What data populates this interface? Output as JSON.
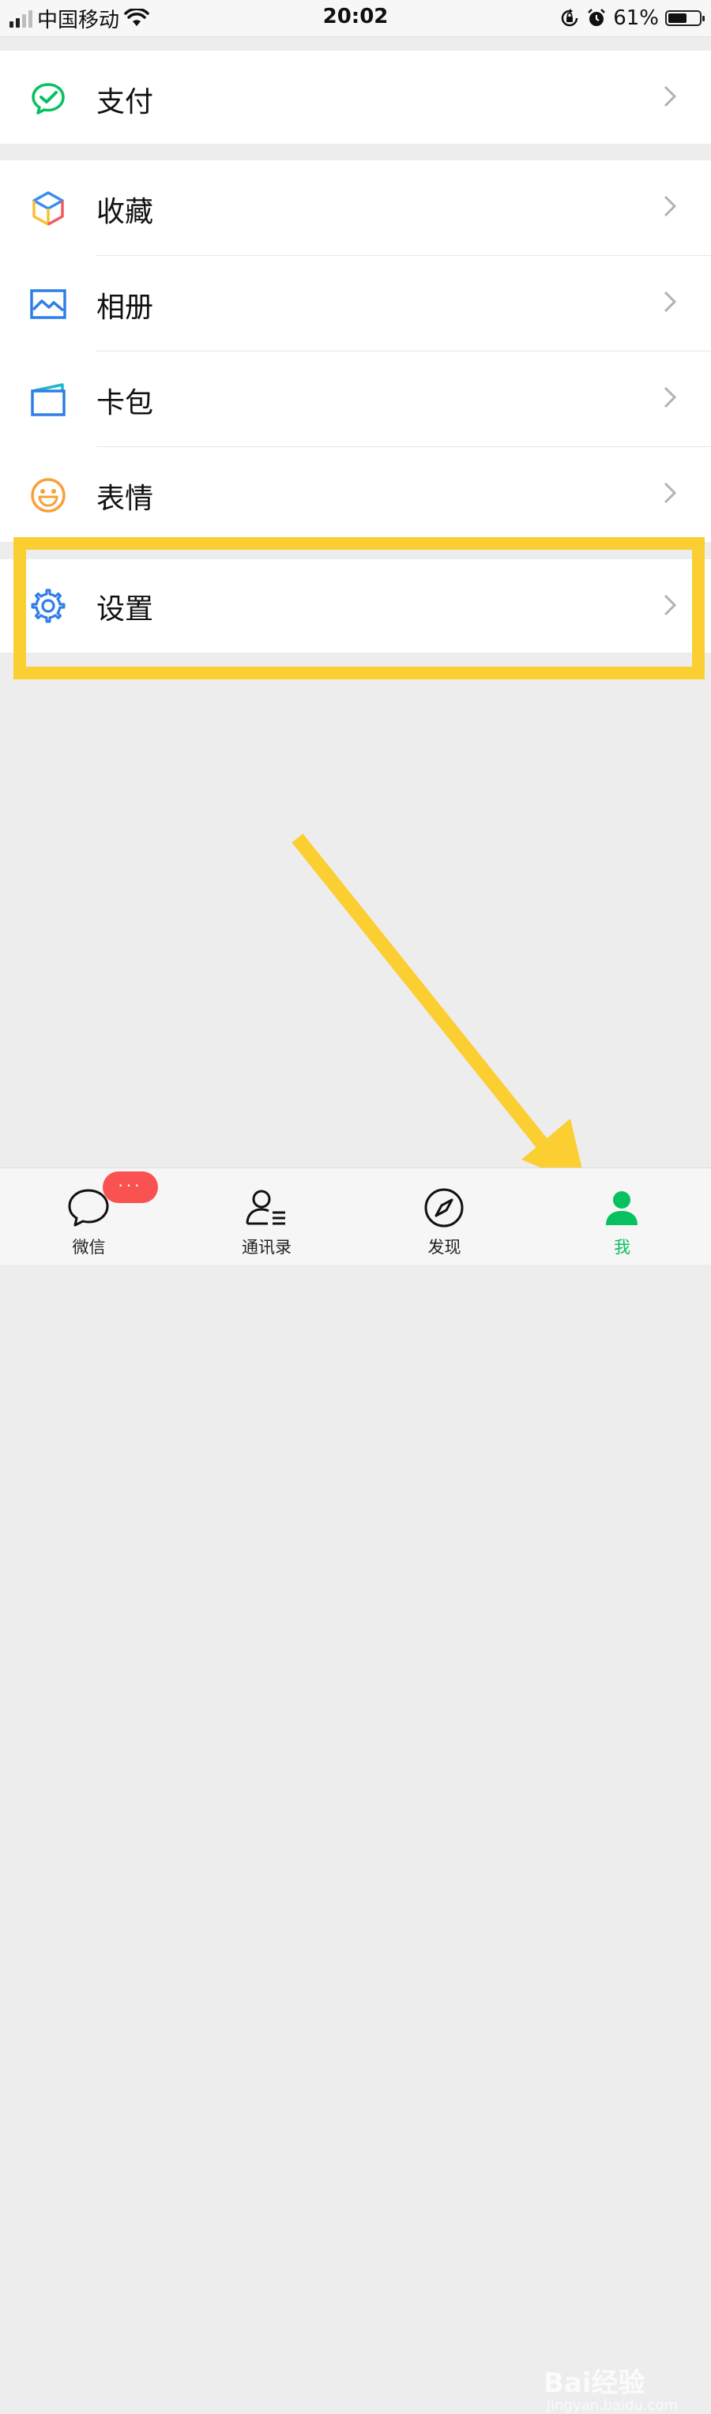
{
  "status_bar": {
    "carrier": "中国移动",
    "time": "20:02",
    "battery_percent": "61%",
    "battery_level": 0.61,
    "icons": [
      "signal-icon",
      "wifi-icon",
      "rotation-lock-icon",
      "alarm-icon",
      "battery-icon"
    ]
  },
  "header": {
    "camera_icon": "camera-icon"
  },
  "menu": {
    "pay": {
      "label": "支付",
      "icon": "wechat-pay-icon",
      "color": "#07c160"
    },
    "favorites": {
      "label": "收藏",
      "icon": "favorites-cube-icon"
    },
    "album": {
      "label": "相册",
      "icon": "album-icon",
      "color": "#2f7ee8"
    },
    "cards": {
      "label": "卡包",
      "icon": "card-wallet-icon",
      "color": "#2f7ee8"
    },
    "stickers": {
      "label": "表情",
      "icon": "sticker-smile-icon",
      "color": "#f5a13a"
    },
    "settings": {
      "label": "设置",
      "icon": "gear-icon",
      "color": "#2f7ee8"
    }
  },
  "annotation": {
    "color": "#fbcf32"
  },
  "tabbar": {
    "tabs": [
      {
        "label": "微信",
        "icon": "chat-bubble-icon",
        "badge": "···"
      },
      {
        "label": "通讯录",
        "icon": "contacts-icon"
      },
      {
        "label": "发现",
        "icon": "compass-icon"
      },
      {
        "label": "我",
        "icon": "me-person-icon",
        "active": true
      }
    ],
    "active_color": "#07c160"
  },
  "watermark": {
    "brand": "Bai经验",
    "url": "jingyan.baidu.com"
  }
}
